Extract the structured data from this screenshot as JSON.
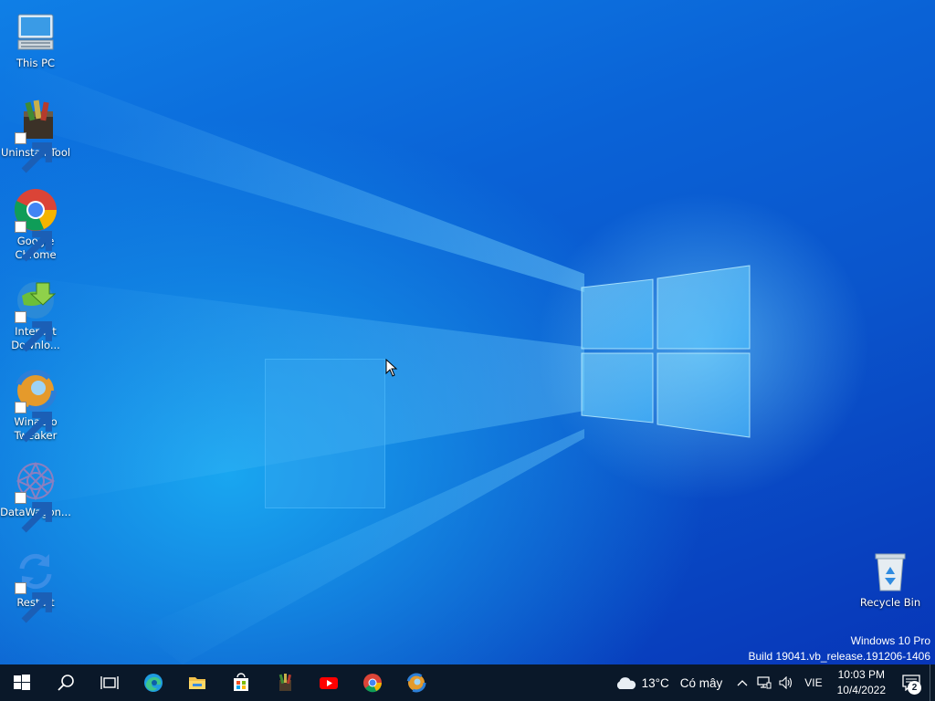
{
  "desktop_icons": [
    {
      "label": "This PC",
      "icon": "computer-icon",
      "shortcut": false
    },
    {
      "label": "Uninstall Tool",
      "icon": "uninstall-tool-icon",
      "shortcut": true
    },
    {
      "label": "Google Chrome",
      "icon": "chrome-icon",
      "shortcut": true
    },
    {
      "label": "Internet Downlo...",
      "icon": "internet-download-manager-icon",
      "shortcut": true
    },
    {
      "label": "Winaero Tweaker",
      "icon": "winaero-tweaker-icon",
      "shortcut": true
    },
    {
      "label": "DataWagon...",
      "icon": "datawagon-icon",
      "shortcut": true
    },
    {
      "label": "Restart",
      "icon": "restart-icon",
      "shortcut": true
    },
    {
      "label": "Recycle Bin",
      "icon": "recycle-bin-icon",
      "shortcut": false
    }
  ],
  "watermark": {
    "line1": "Windows 10 Pro",
    "line2": "Build 19041.vb_release.191206-1406"
  },
  "taskbar": {
    "buttons": [
      "start-icon",
      "search-icon",
      "task-view-icon",
      "edge-icon",
      "file-explorer-icon",
      "microsoft-store-icon",
      "uninstall-tool-icon",
      "youtube-icon",
      "chrome-icon",
      "winaero-tweaker-icon"
    ]
  },
  "tray": {
    "weather_temp": "13°C",
    "weather_desc": "Có mây",
    "language": "VIE",
    "time": "10:03 PM",
    "date": "10/4/2022",
    "notification_count": "2"
  },
  "colors": {
    "taskbar": "#0a1829",
    "desktop_accent": "#0a62d6"
  }
}
